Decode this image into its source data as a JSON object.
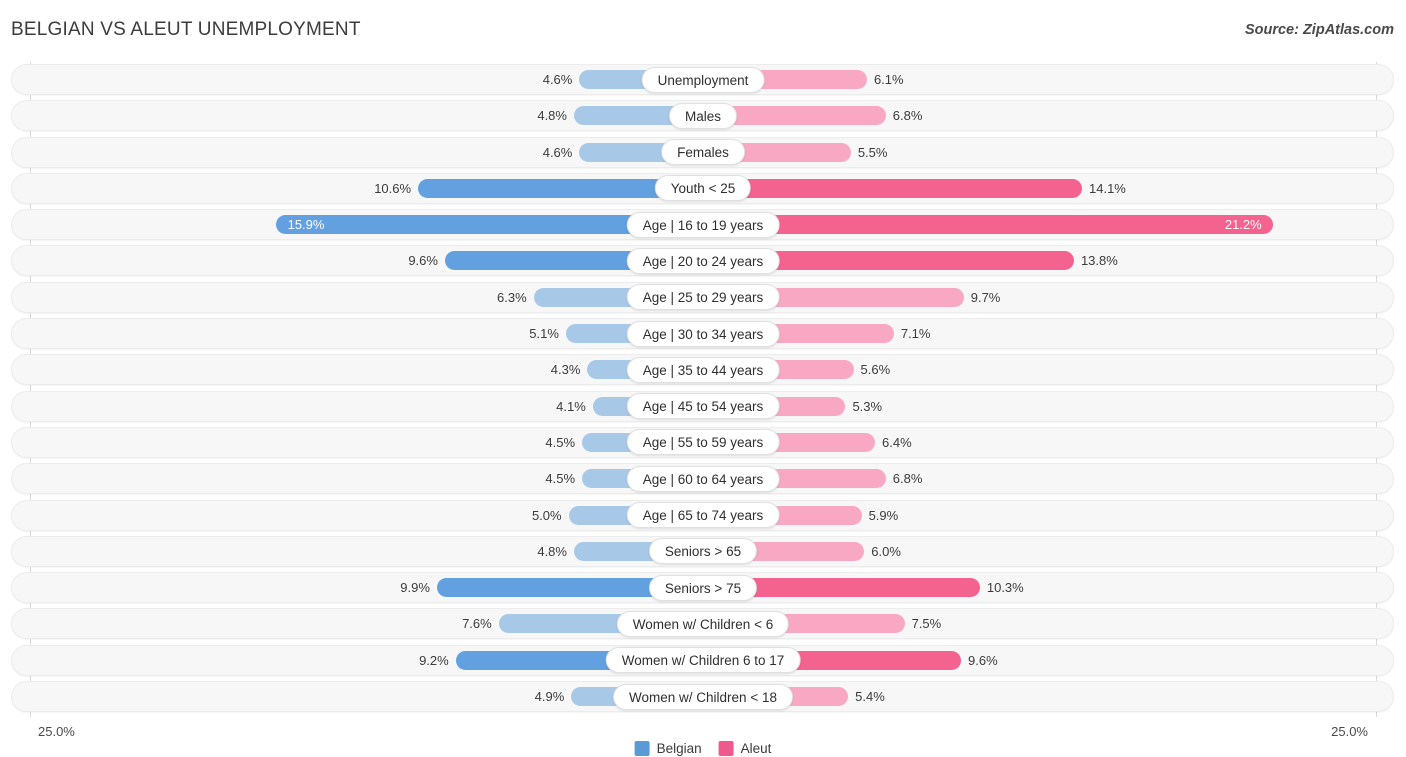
{
  "header": {
    "title": "BELGIAN VS ALEUT UNEMPLOYMENT",
    "source": "Source: ZipAtlas.com"
  },
  "footer": {
    "axis_left": "25.0%",
    "axis_right": "25.0%",
    "legend": [
      {
        "label": "Belgian",
        "color": "#5b9bd5"
      },
      {
        "label": "Aleut",
        "color": "#ef5a8e"
      }
    ]
  },
  "chart_data": {
    "type": "bar",
    "title": "BELGIAN VS ALEUT UNEMPLOYMENT",
    "subtitle": "Source: ZipAtlas.com",
    "orientation": "horizontal-diverging",
    "xlabel": "",
    "ylabel": "",
    "axis_max_percent": 25.0,
    "axis_left_label": "25.0%",
    "axis_right_label": "25.0%",
    "legend_position": "bottom-center",
    "grid": false,
    "series": [
      {
        "name": "Belgian",
        "color": "#a8c8e8",
        "color_highlight": "#63a0e0",
        "side": "left",
        "values": [
          4.6,
          4.8,
          4.6,
          10.6,
          15.9,
          9.6,
          6.3,
          5.1,
          4.3,
          4.1,
          4.5,
          4.5,
          5.0,
          4.8,
          9.9,
          7.6,
          9.2,
          4.9
        ]
      },
      {
        "name": "Aleut",
        "color": "#f9a8c4",
        "color_highlight": "#f4628f",
        "side": "right",
        "values": [
          6.1,
          6.8,
          5.5,
          14.1,
          21.2,
          13.8,
          9.7,
          7.1,
          5.6,
          5.3,
          6.4,
          6.8,
          5.9,
          6.0,
          10.3,
          7.5,
          9.6,
          5.4
        ]
      }
    ],
    "categories": [
      "Unemployment",
      "Males",
      "Females",
      "Youth < 25",
      "Age | 16 to 19 years",
      "Age | 20 to 24 years",
      "Age | 25 to 29 years",
      "Age | 30 to 34 years",
      "Age | 35 to 44 years",
      "Age | 45 to 54 years",
      "Age | 55 to 59 years",
      "Age | 60 to 64 years",
      "Age | 65 to 74 years",
      "Seniors > 65",
      "Seniors > 75",
      "Women w/ Children < 6",
      "Women w/ Children 6 to 17",
      "Women w/ Children < 18"
    ],
    "rows": [
      {
        "label": "Unemployment",
        "left_value": 4.6,
        "left_text": "4.6%",
        "right_value": 6.1,
        "right_text": "6.1%",
        "highlight": false
      },
      {
        "label": "Males",
        "left_value": 4.8,
        "left_text": "4.8%",
        "right_value": 6.8,
        "right_text": "6.8%",
        "highlight": false
      },
      {
        "label": "Females",
        "left_value": 4.6,
        "left_text": "4.6%",
        "right_value": 5.5,
        "right_text": "5.5%",
        "highlight": false
      },
      {
        "label": "Youth < 25",
        "left_value": 10.6,
        "left_text": "10.6%",
        "right_value": 14.1,
        "right_text": "14.1%",
        "highlight": true
      },
      {
        "label": "Age | 16 to 19 years",
        "left_value": 15.9,
        "left_text": "15.9%",
        "right_value": 21.2,
        "right_text": "21.2%",
        "highlight": true,
        "inside": true
      },
      {
        "label": "Age | 20 to 24 years",
        "left_value": 9.6,
        "left_text": "9.6%",
        "right_value": 13.8,
        "right_text": "13.8%",
        "highlight": true
      },
      {
        "label": "Age | 25 to 29 years",
        "left_value": 6.3,
        "left_text": "6.3%",
        "right_value": 9.7,
        "right_text": "9.7%",
        "highlight": false
      },
      {
        "label": "Age | 30 to 34 years",
        "left_value": 5.1,
        "left_text": "5.1%",
        "right_value": 7.1,
        "right_text": "7.1%",
        "highlight": false
      },
      {
        "label": "Age | 35 to 44 years",
        "left_value": 4.3,
        "left_text": "4.3%",
        "right_value": 5.6,
        "right_text": "5.6%",
        "highlight": false
      },
      {
        "label": "Age | 45 to 54 years",
        "left_value": 4.1,
        "left_text": "4.1%",
        "right_value": 5.3,
        "right_text": "5.3%",
        "highlight": false
      },
      {
        "label": "Age | 55 to 59 years",
        "left_value": 4.5,
        "left_text": "4.5%",
        "right_value": 6.4,
        "right_text": "6.4%",
        "highlight": false
      },
      {
        "label": "Age | 60 to 64 years",
        "left_value": 4.5,
        "left_text": "4.5%",
        "right_value": 6.8,
        "right_text": "6.8%",
        "highlight": false
      },
      {
        "label": "Age | 65 to 74 years",
        "left_value": 5.0,
        "left_text": "5.0%",
        "right_value": 5.9,
        "right_text": "5.9%",
        "highlight": false
      },
      {
        "label": "Seniors > 65",
        "left_value": 4.8,
        "left_text": "4.8%",
        "right_value": 6.0,
        "right_text": "6.0%",
        "highlight": false
      },
      {
        "label": "Seniors > 75",
        "left_value": 9.9,
        "left_text": "9.9%",
        "right_value": 10.3,
        "right_text": "10.3%",
        "highlight": true
      },
      {
        "label": "Women w/ Children < 6",
        "left_value": 7.6,
        "left_text": "7.6%",
        "right_value": 7.5,
        "right_text": "7.5%",
        "highlight": false
      },
      {
        "label": "Women w/ Children 6 to 17",
        "left_value": 9.2,
        "left_text": "9.2%",
        "right_value": 9.6,
        "right_text": "9.6%",
        "highlight": true
      },
      {
        "label": "Women w/ Children < 18",
        "left_value": 4.9,
        "left_text": "4.9%",
        "right_value": 5.4,
        "right_text": "5.4%",
        "highlight": false
      }
    ]
  }
}
